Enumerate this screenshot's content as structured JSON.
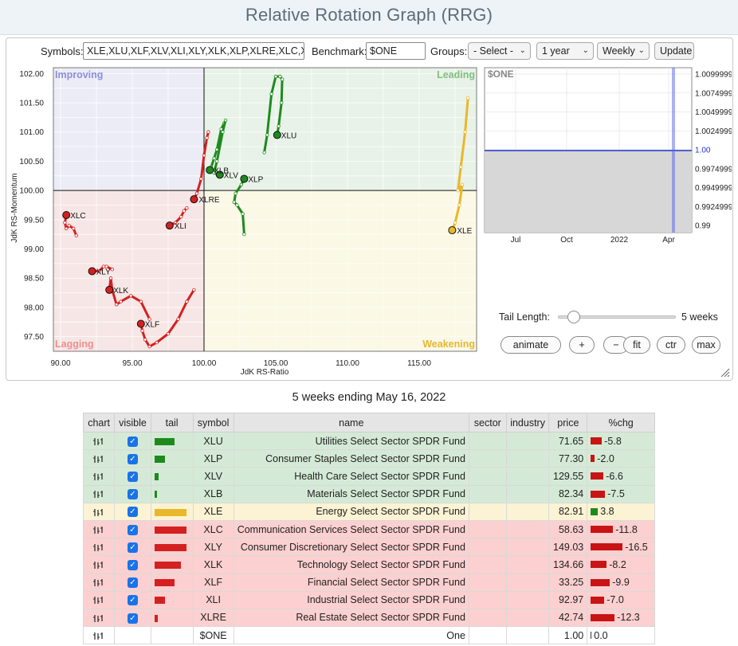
{
  "app_title": "Relative Rotation Graph (RRG)",
  "controls": {
    "symbols_label": "Symbols:",
    "symbols_value": "XLE,XLU,XLF,XLV,XLI,XLY,XLK,XLP,XLRE,XLC,XLB",
    "benchmark_label": "Benchmark:",
    "benchmark_value": "$ONE",
    "groups_label": "Groups:",
    "groups_selected": "- Select -",
    "period_selected": "1 year",
    "interval_selected": "Weekly",
    "update_label": "Update"
  },
  "rrg_chart": {
    "x_axis_label": "JdK RS-Ratio",
    "y_axis_label": "JdK RS-Momentum",
    "x_ticks": [
      "90.00",
      "95.00",
      "100.00",
      "105.00",
      "110.00",
      "115.00"
    ],
    "y_ticks": [
      "102.00",
      "101.50",
      "101.00",
      "100.50",
      "100.00",
      "99.50",
      "99.00",
      "98.50",
      "98.00",
      "97.50"
    ],
    "quadrants": {
      "improving": "Improving",
      "leading": "Leading",
      "lagging": "Lagging",
      "weakening": "Weakening"
    },
    "colors": {
      "leading": "#1e8a1e",
      "weakening": "#e8b82a",
      "lagging": "#d42020",
      "improving_bg": "#ececf7",
      "leading_bg": "#e8f2e8",
      "lagging_bg": "#f7e6e6",
      "weakening_bg": "#fbf8e6"
    },
    "labels": [
      "XLU",
      "XLB",
      "XLV",
      "XLP",
      "XLRE",
      "XLI",
      "XLC",
      "XLY",
      "XLK",
      "XLF",
      "XLE"
    ]
  },
  "mini_chart": {
    "title": "$ONE",
    "y_ticks": [
      "1.0099999",
      "1.0074999",
      "1.0049999",
      "1.0024999",
      "1.00",
      "0.9974999",
      "0.9949999",
      "0.9924999",
      "0.99"
    ],
    "x_ticks": [
      "Jul",
      "Oct",
      "2022",
      "Apr"
    ],
    "line_color": "#2233cc"
  },
  "tail_length": {
    "label": "Tail Length:",
    "value_text": "5 weeks",
    "weeks": 5
  },
  "buttons": {
    "animate": "animate",
    "plus": "+",
    "minus": "−",
    "fit": "fit",
    "ctr": "ctr",
    "max": "max"
  },
  "subtitle": "5 weeks ending May 16, 2022",
  "table": {
    "headers": {
      "chart": "chart",
      "visible": "visible",
      "tail": "tail",
      "symbol": "symbol",
      "name": "name",
      "sector": "sector",
      "industry": "industry",
      "price": "price",
      "chg": "%chg"
    },
    "rows": [
      {
        "quadrant": "leading",
        "symbol": "XLU",
        "name": "Utilities Select Sector SPDR Fund",
        "sector": "",
        "industry": "",
        "price": "71.65",
        "chg": "-5.8",
        "tail": 0.6,
        "chg_value": -5.8
      },
      {
        "quadrant": "leading",
        "symbol": "XLP",
        "name": "Consumer Staples Select Sector SPDR Fund",
        "sector": "",
        "industry": "",
        "price": "77.30",
        "chg": "-2.0",
        "tail": 0.3,
        "chg_value": -2.0
      },
      {
        "quadrant": "leading",
        "symbol": "XLV",
        "name": "Health Care Select Sector SPDR Fund",
        "sector": "",
        "industry": "",
        "price": "129.55",
        "chg": "-6.6",
        "tail": 0.13,
        "chg_value": -6.6
      },
      {
        "quadrant": "leading",
        "symbol": "XLB",
        "name": "Materials Select Sector SPDR Fund",
        "sector": "",
        "industry": "",
        "price": "82.34",
        "chg": "-7.5",
        "tail": 0.08,
        "chg_value": -7.5
      },
      {
        "quadrant": "weakening",
        "symbol": "XLE",
        "name": "Energy Select Sector SPDR Fund",
        "sector": "",
        "industry": "",
        "price": "82.91",
        "chg": "3.8",
        "tail": 0.95,
        "chg_value": 3.8
      },
      {
        "quadrant": "lagging",
        "symbol": "XLC",
        "name": "Communication Services Select Sector SPDR Fund",
        "sector": "",
        "industry": "",
        "price": "58.63",
        "chg": "-11.8",
        "tail": 0.95,
        "chg_value": -11.8
      },
      {
        "quadrant": "lagging",
        "symbol": "XLY",
        "name": "Consumer Discretionary Select Sector SPDR Fund",
        "sector": "",
        "industry": "",
        "price": "149.03",
        "chg": "-16.5",
        "tail": 0.95,
        "chg_value": -16.5
      },
      {
        "quadrant": "lagging",
        "symbol": "XLK",
        "name": "Technology Select Sector SPDR Fund",
        "sector": "",
        "industry": "",
        "price": "134.66",
        "chg": "-8.2",
        "tail": 0.78,
        "chg_value": -8.2
      },
      {
        "quadrant": "lagging",
        "symbol": "XLF",
        "name": "Financial Select Sector SPDR Fund",
        "sector": "",
        "industry": "",
        "price": "33.25",
        "chg": "-9.9",
        "tail": 0.6,
        "chg_value": -9.9
      },
      {
        "quadrant": "lagging",
        "symbol": "XLI",
        "name": "Industrial Select Sector SPDR Fund",
        "sector": "",
        "industry": "",
        "price": "92.97",
        "chg": "-7.0",
        "tail": 0.3,
        "chg_value": -7.0
      },
      {
        "quadrant": "lagging",
        "symbol": "XLRE",
        "name": "Real Estate Select Sector SPDR Fund",
        "sector": "",
        "industry": "",
        "price": "42.74",
        "chg": "-12.3",
        "tail": 0.1,
        "chg_value": -12.3
      },
      {
        "quadrant": "bench",
        "symbol": "$ONE",
        "name": "One",
        "sector": "",
        "industry": "",
        "price": "1.00",
        "chg": "0.0",
        "tail": 0,
        "chg_value": 0.0
      }
    ]
  }
}
